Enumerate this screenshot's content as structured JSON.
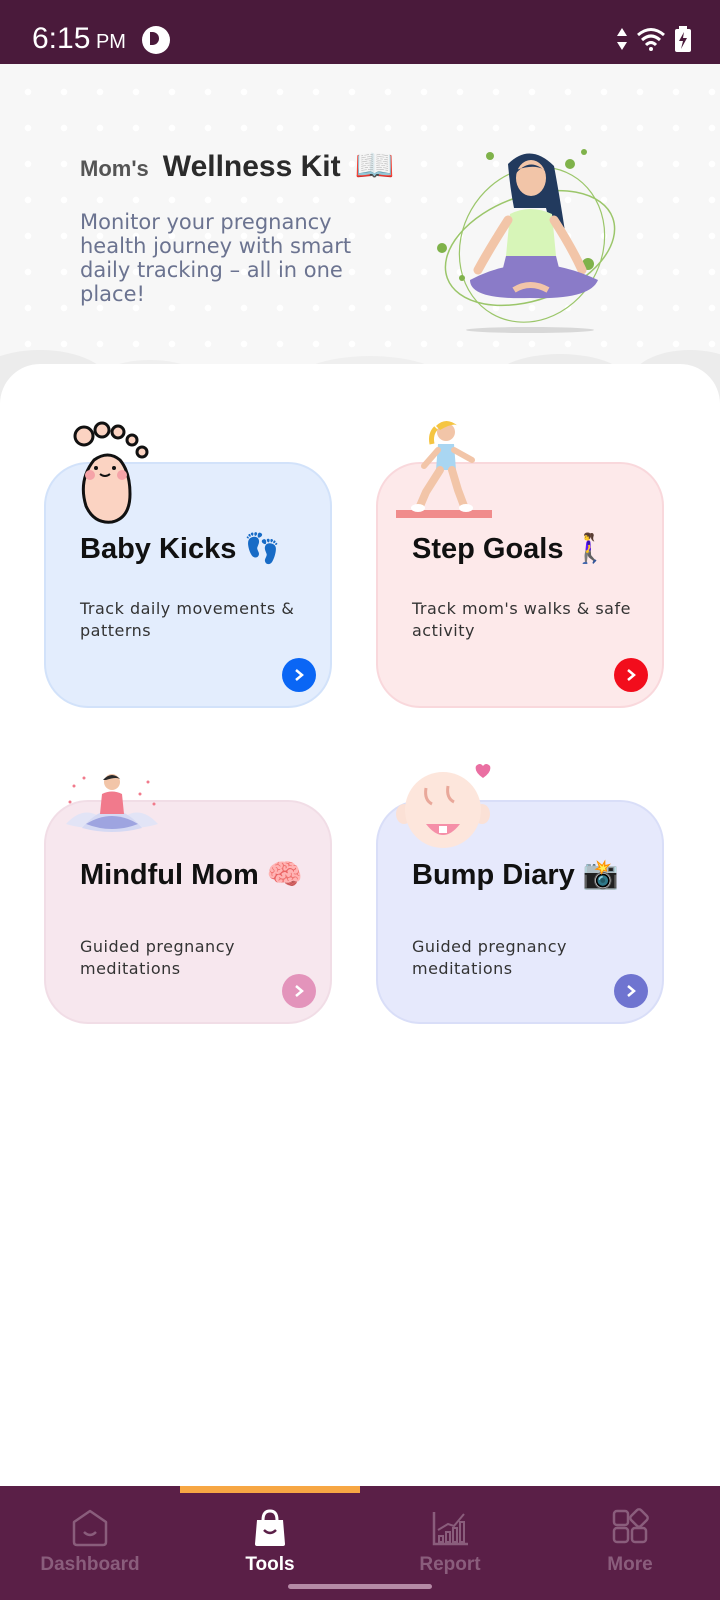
{
  "status_bar": {
    "time": "6:15",
    "ampm": "PM",
    "icons": [
      "app-icon",
      "data-arrows-icon",
      "wifi-icon",
      "battery-charging-icon"
    ]
  },
  "header": {
    "pre_title": "Mom's",
    "title": "Wellness Kit",
    "title_emoji": "📖",
    "description": "Monitor your pregnancy health journey with smart daily tracking – all in one place!",
    "illustration": "meditating-woman-illustration"
  },
  "cards": [
    {
      "title": "Baby Kicks",
      "emoji": "👣",
      "description": "Track daily movements & patterns",
      "illustration": "baby-foot-illustration",
      "accent": "#0a66f5"
    },
    {
      "title": "Step Goals",
      "emoji": "🚶‍♀️",
      "description": "Track mom's walks & safe activity",
      "illustration": "walking-woman-illustration",
      "accent": "#f20d1c"
    },
    {
      "title": "Mindful Mom",
      "emoji": "🧠",
      "description": "Guided pregnancy meditations",
      "illustration": "meditation-lotus-illustration",
      "accent": "#e394bb"
    },
    {
      "title": "Bump Diary",
      "emoji": "📸",
      "description": "Guided pregnancy meditations",
      "illustration": "baby-face-illustration",
      "accent": "#6f74d0"
    }
  ],
  "bottom_nav": {
    "items": [
      {
        "label": "Dashboard",
        "icon": "home-icon",
        "active": false
      },
      {
        "label": "Tools",
        "icon": "shopping-bag-icon",
        "active": true
      },
      {
        "label": "Report",
        "icon": "bar-chart-icon",
        "active": false
      },
      {
        "label": "More",
        "icon": "grid-icon",
        "active": false
      }
    ],
    "indicator_color": "#f7a744"
  },
  "colors": {
    "status_bar": "#4a1a3b",
    "nav_bg": "#5a1f47",
    "desc_text": "#6b7390"
  }
}
